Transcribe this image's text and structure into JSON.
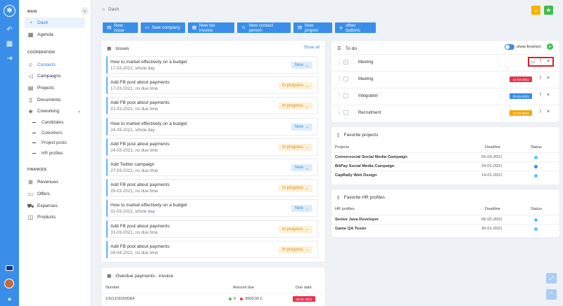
{
  "sidebar": {
    "sections": {
      "main": "MAIN",
      "cooperation": "COOPERATION",
      "finances": "FINANCES"
    },
    "items": {
      "dash": "Dash",
      "agenda": "Agenda",
      "contacts": "Contacts",
      "campaigns": "Campaigns",
      "projects": "Projects",
      "documents": "Documents",
      "coworking": "Coworking",
      "candidates": "Candidates",
      "coworkers": "Coworkers",
      "project_posts": "Project posts",
      "hr_profiles": "HR profiles",
      "revenues": "Revenues",
      "offers": "Offers",
      "expenses": "Expenses",
      "products": "Products"
    }
  },
  "breadcrumb": "Dash",
  "toolbar": {
    "new_issue": "New issue",
    "new_company": "New company",
    "new_tax_invoice": "New tax invoice",
    "new_contact_person": "New contact person",
    "new_project": "New project",
    "other_buttons": "other buttons"
  },
  "issues": {
    "title": "Issues",
    "show_all": "Show all",
    "items": [
      {
        "title": "How tu market effectively on a budget",
        "meta": "17-03-2021, whole day",
        "status": "New",
        "kind": "new"
      },
      {
        "title": "Add FB post about payments",
        "meta": "17-03-2021, no due time",
        "status": "In progress",
        "kind": "prog"
      },
      {
        "title": "Add FB post about payments",
        "meta": "21-03-2021, no due time",
        "status": "In progress",
        "kind": "prog"
      },
      {
        "title": "How tu market effectively on a budget",
        "meta": "24-03-2021, whole day",
        "status": "New",
        "kind": "new"
      },
      {
        "title": "Add FB post about payments",
        "meta": "24-03-2021, no due time",
        "status": "In progress",
        "kind": "prog"
      },
      {
        "title": "Add Twitter campaign",
        "meta": "27-03-2021, no due time",
        "status": "New",
        "kind": "new"
      },
      {
        "title": "Add FB post about payments",
        "meta": "28-03-2021, no due time",
        "status": "In progress",
        "kind": "prog"
      },
      {
        "title": "How tu market effectively on a budget",
        "meta": "31-03-2021, whole day",
        "status": "New",
        "kind": "new"
      },
      {
        "title": "Add FB post about payments",
        "meta": "31-03-2021, no due time",
        "status": "In progress",
        "kind": "prog"
      },
      {
        "title": "Add FB post about payments",
        "meta": "04-04-2021, no due time",
        "status": "In progress",
        "kind": "prog"
      }
    ]
  },
  "overdue": {
    "title": "Overdue payments - invoice",
    "headers": {
      "number": "Number",
      "amount": "Amount due",
      "due": "Due date"
    },
    "rows": [
      {
        "number": "1/5/12/2020/DEF",
        "amount1": "0",
        "amount2": "3000,00 £",
        "due": "05-01-2021"
      }
    ]
  },
  "todo": {
    "title": "To do",
    "show_finished": "show finished",
    "items": [
      {
        "label": "Meeting",
        "date": "",
        "color": "",
        "checked": true
      },
      {
        "label": "Meeting",
        "date": "14-03-2021",
        "color": "#e8344e",
        "checked": false
      },
      {
        "label": "Integration",
        "date": "20-03-2021",
        "color": "#3a8eea",
        "checked": false
      },
      {
        "label": "Recruitment",
        "date": "16-03-2021",
        "color": "#f3a712",
        "checked": false
      }
    ]
  },
  "fav_projects": {
    "title": "Favorite projects",
    "headers": {
      "name": "Projects",
      "deadline": "Deadline",
      "status": "Status"
    },
    "rows": [
      {
        "name": "Conversocial Social Media Campaign",
        "deadline": "05-03-2021",
        "color": "#56c8ee"
      },
      {
        "name": "BitPay Social Media Campaign",
        "deadline": "29-01-2021",
        "color": "#3a8eea"
      },
      {
        "name": "CapRally Web Design",
        "deadline": "14-01-2021",
        "color": "#56c8ee"
      }
    ]
  },
  "fav_hr": {
    "title": "Favorite HR profiles",
    "headers": {
      "name": "HR profiles",
      "deadline": "Deadline",
      "status": "Status"
    },
    "rows": [
      {
        "name": "Senior Java Developer",
        "deadline": "06-02-2021",
        "color": "#56c8ee"
      },
      {
        "name": "Game QA Tester",
        "deadline": "30-01-2021",
        "color": "#56c8ee"
      }
    ]
  },
  "colors": {
    "primary": "#3a8eea",
    "bell": "#f5b400",
    "star": "#3fbf4a",
    "highlight": "#e01e2b"
  }
}
